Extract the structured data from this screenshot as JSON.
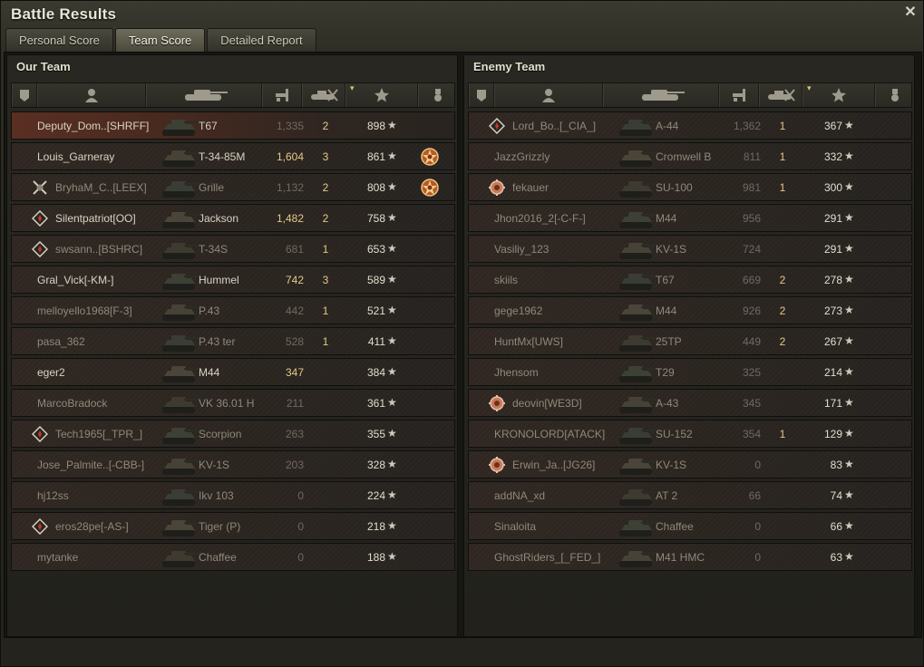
{
  "window": {
    "title": "Battle Results",
    "close_glyph": "✕"
  },
  "tabs": [
    {
      "label": "Personal Score",
      "active": false
    },
    {
      "label": "Team Score",
      "active": true
    },
    {
      "label": "Detailed Report",
      "active": false
    }
  ],
  "our_team": {
    "title": "Our Team",
    "rows": [
      {
        "name": "Deputy_Dom..[SHRFF]",
        "badge": "",
        "vehicle": "T67",
        "damage": "1,335",
        "damage_hi": false,
        "kills": "2",
        "xp": "898",
        "medal": "",
        "state": "first"
      },
      {
        "name": "Louis_Garneray",
        "badge": "",
        "vehicle": "T-34-85M",
        "damage": "1,604",
        "damage_hi": true,
        "kills": "3",
        "xp": "861",
        "medal": "medal-icon",
        "state": "alive"
      },
      {
        "name": "BryhaM_C..[LEEX]",
        "badge": "crossed-swords-icon",
        "vehicle": "Grille",
        "damage": "1,132",
        "damage_hi": false,
        "kills": "2",
        "xp": "808",
        "medal": "medal-icon",
        "state": "dim"
      },
      {
        "name": "Silentpatriot[OO]",
        "badge": "diamond-icon",
        "vehicle": "Jackson",
        "damage": "1,482",
        "damage_hi": true,
        "kills": "2",
        "xp": "758",
        "medal": "",
        "state": "alive"
      },
      {
        "name": "swsann..[BSHRC]",
        "badge": "diamond-icon",
        "vehicle": "T-34S",
        "damage": "681",
        "damage_hi": false,
        "kills": "1",
        "xp": "653",
        "medal": "",
        "state": "dim"
      },
      {
        "name": "Gral_Vick[-KM-]",
        "badge": "",
        "vehicle": "Hummel",
        "damage": "742",
        "damage_hi": true,
        "kills": "3",
        "xp": "589",
        "medal": "",
        "state": "alive"
      },
      {
        "name": "melloyello1968[F-3]",
        "badge": "",
        "vehicle": "P.43",
        "damage": "442",
        "damage_hi": false,
        "kills": "1",
        "xp": "521",
        "medal": "",
        "state": "dim"
      },
      {
        "name": "pasa_362",
        "badge": "",
        "vehicle": "P.43 ter",
        "damage": "528",
        "damage_hi": false,
        "kills": "1",
        "xp": "411",
        "medal": "",
        "state": "dim"
      },
      {
        "name": "eger2",
        "badge": "",
        "vehicle": "M44",
        "damage": "347",
        "damage_hi": true,
        "kills": "",
        "xp": "384",
        "medal": "",
        "state": "alive"
      },
      {
        "name": "MarcoBradock",
        "badge": "",
        "vehicle": "VK 36.01 H",
        "damage": "211",
        "damage_hi": false,
        "kills": "",
        "xp": "361",
        "medal": "",
        "state": "dim"
      },
      {
        "name": "Tech1965[_TPR_]",
        "badge": "diamond-icon",
        "vehicle": "Scorpion",
        "damage": "263",
        "damage_hi": false,
        "kills": "",
        "xp": "355",
        "medal": "",
        "state": "dim"
      },
      {
        "name": "Jose_Palmite..[-CBB-]",
        "badge": "",
        "vehicle": "KV-1S",
        "damage": "203",
        "damage_hi": false,
        "kills": "",
        "xp": "328",
        "medal": "",
        "state": "dim"
      },
      {
        "name": "hj12ss",
        "badge": "",
        "vehicle": "Ikv 103",
        "damage": "0",
        "damage_hi": false,
        "kills": "",
        "xp": "224",
        "medal": "",
        "state": "dim"
      },
      {
        "name": "eros28pe[-AS-]",
        "badge": "diamond-icon",
        "vehicle": "Tiger (P)",
        "damage": "0",
        "damage_hi": false,
        "kills": "",
        "xp": "218",
        "medal": "",
        "state": "dim"
      },
      {
        "name": "mytanke",
        "badge": "",
        "vehicle": "Chaffee",
        "damage": "0",
        "damage_hi": false,
        "kills": "",
        "xp": "188",
        "medal": "",
        "state": "dim"
      }
    ]
  },
  "enemy_team": {
    "title": "Enemy Team",
    "rows": [
      {
        "name": "Lord_Bo..[_CIA_]",
        "badge": "diamond-icon",
        "vehicle": "A-44",
        "damage": "1,362",
        "damage_hi": false,
        "kills": "1",
        "xp": "367",
        "medal": "",
        "state": "dim"
      },
      {
        "name": "JazzGrizzly",
        "badge": "",
        "vehicle": "Cromwell B",
        "damage": "811",
        "damage_hi": false,
        "kills": "1",
        "xp": "332",
        "medal": "",
        "state": "dim"
      },
      {
        "name": "fekauer",
        "badge": "gear-emblem-icon",
        "vehicle": "SU-100",
        "damage": "981",
        "damage_hi": false,
        "kills": "1",
        "xp": "300",
        "medal": "",
        "state": "dim"
      },
      {
        "name": "Jhon2016_2[-C-F-]",
        "badge": "",
        "vehicle": "M44",
        "damage": "956",
        "damage_hi": false,
        "kills": "",
        "xp": "291",
        "medal": "",
        "state": "dim"
      },
      {
        "name": "Vasiliy_123",
        "badge": "",
        "vehicle": "KV-1S",
        "damage": "724",
        "damage_hi": false,
        "kills": "",
        "xp": "291",
        "medal": "",
        "state": "dim"
      },
      {
        "name": "skiils",
        "badge": "",
        "vehicle": "T67",
        "damage": "669",
        "damage_hi": false,
        "kills": "2",
        "xp": "278",
        "medal": "",
        "state": "dim"
      },
      {
        "name": "gege1962",
        "badge": "",
        "vehicle": "M44",
        "damage": "926",
        "damage_hi": false,
        "kills": "2",
        "xp": "273",
        "medal": "",
        "state": "dim"
      },
      {
        "name": "HuntMx[UWS]",
        "badge": "",
        "vehicle": "25TP",
        "damage": "449",
        "damage_hi": false,
        "kills": "2",
        "xp": "267",
        "medal": "",
        "state": "dim"
      },
      {
        "name": "Jhensom",
        "badge": "",
        "vehicle": "T29",
        "damage": "325",
        "damage_hi": false,
        "kills": "",
        "xp": "214",
        "medal": "",
        "state": "dim"
      },
      {
        "name": "deovin[WE3D]",
        "badge": "gear-emblem-icon",
        "vehicle": "A-43",
        "damage": "345",
        "damage_hi": false,
        "kills": "",
        "xp": "171",
        "medal": "",
        "state": "dim"
      },
      {
        "name": "KRONOLORD[ATACK]",
        "badge": "",
        "vehicle": "SU-152",
        "damage": "354",
        "damage_hi": false,
        "kills": "1",
        "xp": "129",
        "medal": "",
        "state": "dim"
      },
      {
        "name": "Erwin_Ja..[JG26]",
        "badge": "gear-emblem-icon",
        "vehicle": "KV-1S",
        "damage": "0",
        "damage_hi": false,
        "kills": "",
        "xp": "83",
        "medal": "",
        "state": "dim"
      },
      {
        "name": "addNA_xd",
        "badge": "",
        "vehicle": "AT 2",
        "damage": "66",
        "damage_hi": false,
        "kills": "",
        "xp": "74",
        "medal": "",
        "state": "dim"
      },
      {
        "name": "Sinaloita",
        "badge": "",
        "vehicle": "Chaffee",
        "damage": "0",
        "damage_hi": false,
        "kills": "",
        "xp": "66",
        "medal": "",
        "state": "dim"
      },
      {
        "name": "GhostRiders_[_FED_]",
        "badge": "",
        "vehicle": "M41 HMC",
        "damage": "0",
        "damage_hi": false,
        "kills": "",
        "xp": "63",
        "medal": "",
        "state": "dim"
      }
    ]
  },
  "columns": {
    "badge_icon": "rank-badge-icon",
    "player_icon": "player-icon",
    "vehicle_icon": "tank-icon",
    "damage_icon": "damage-icon",
    "kills_icon": "kills-icon",
    "xp_icon": "star-icon",
    "medal_icon": "medal-icon",
    "star_glyph": "★"
  },
  "colors": {
    "damage_highlight": "#e6c98a",
    "kills": "#e6c98a",
    "first_row": "#5a2f22"
  }
}
